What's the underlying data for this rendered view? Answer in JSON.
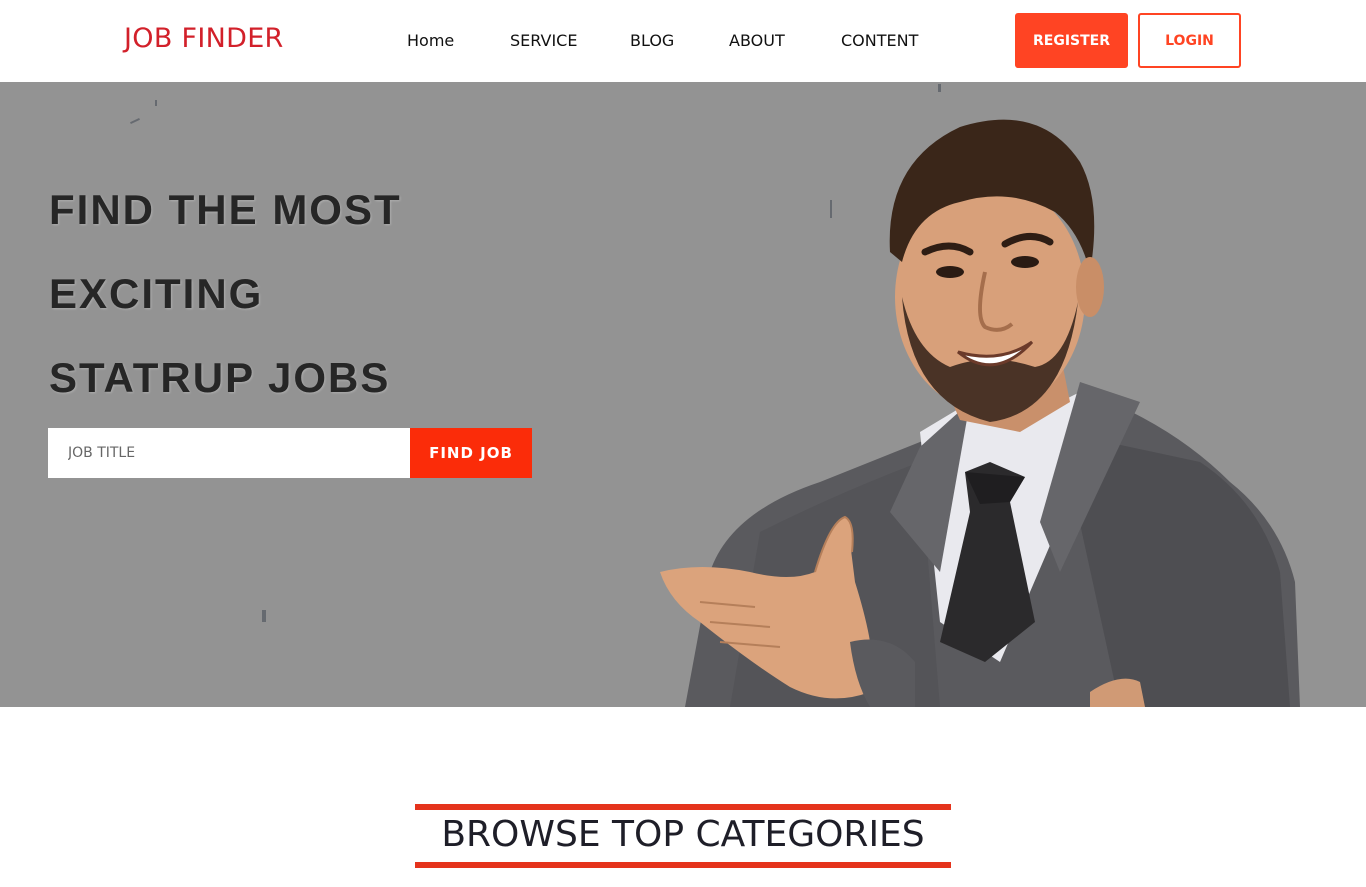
{
  "header": {
    "logo": "JOB FINDER",
    "nav": [
      "Home",
      "SERVICE",
      "BLOG",
      "ABOUT",
      "CONTENT"
    ],
    "register_label": "REGISTER",
    "login_label": "LOGIN"
  },
  "hero": {
    "headline_lines": [
      "FIND THE MOST",
      "EXCITING",
      "STATRUP JOBS"
    ],
    "search_placeholder": "JOB TITLE",
    "search_button": "FIND JOB"
  },
  "categories": {
    "title": "BROWSE TOP CATEGORIES"
  },
  "colors": {
    "brand_red": "#d2202a",
    "accent_orange": "#ff4423",
    "search_button": "#fb2c09",
    "hero_overlay": "#939393"
  }
}
